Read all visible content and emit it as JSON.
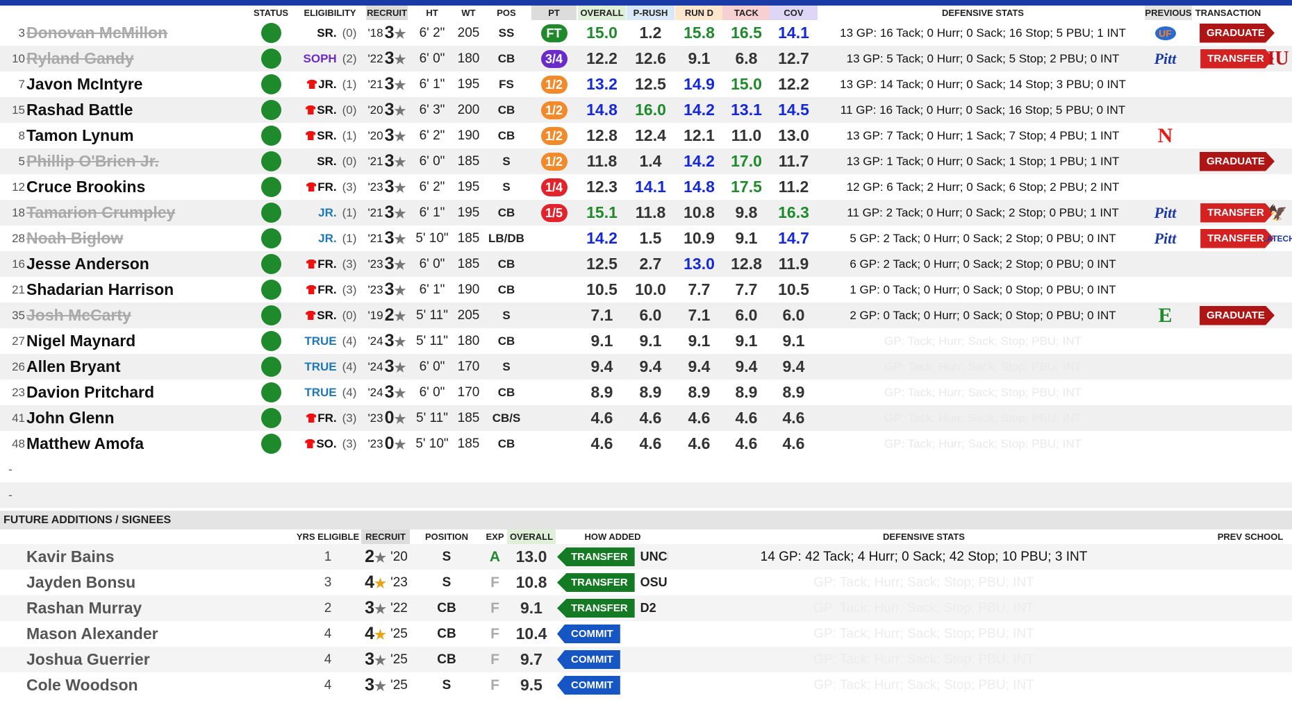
{
  "headers": {
    "status": "STATUS",
    "eligibility": "ELIGIBILITY",
    "recruit": "RECRUIT",
    "ht": "HT",
    "wt": "WT",
    "pos": "POS",
    "pt": "PT",
    "overall": "OVERALL",
    "prush": "P-RUSH",
    "rund": "RUN D",
    "tack": "TACK",
    "cov": "COV",
    "defstats": "DEFENSIVE STATS",
    "previous": "PREVIOUS",
    "transaction": "TRANSACTION"
  },
  "colors": {
    "green": "#1e8a2c",
    "blue": "#1428d8",
    "orange": "#f08a2a",
    "red": "#e3232c",
    "purple": "#6a2bc9",
    "header_blue": "#1a3aa5"
  },
  "players": [
    {
      "num": "3",
      "name": "Donovan McMillon",
      "gone": true,
      "elig": "SR.",
      "ecolor": "#111",
      "redshirt": false,
      "eyrs": "(0)",
      "yr": "'18",
      "stars": "3",
      "ht": "6' 2\"",
      "wt": "205",
      "pos": "SS",
      "pt": "FT",
      "ptc": "ft",
      "ov": "15.0",
      "ovc": "g",
      "pr": "1.2",
      "prc": "",
      "rd": "15.8",
      "rdc": "g",
      "tk": "16.5",
      "tkc": "g",
      "cv": "14.1",
      "cvc": "b",
      "ds": "13 GP: 16 Tack; 0 Hurr; 0 Sack; 16 Stop; 5 PBU; 1 INT",
      "dsf": false,
      "prev": "UF",
      "prevc": "fl",
      "trans": "GRADUATE",
      "tc": "grad",
      "next": "",
      "nextc": ""
    },
    {
      "num": "10",
      "name": "Ryland Gandy",
      "gone": true,
      "elig": "SOPH",
      "ecolor": "#6a2bc9",
      "redshirt": false,
      "eyrs": "(2)",
      "yr": "'22",
      "stars": "3",
      "ht": "6' 0\"",
      "wt": "180",
      "pos": "CB",
      "pt": "3/4",
      "ptc": "p34",
      "ov": "12.2",
      "ovc": "",
      "pr": "12.6",
      "prc": "",
      "rd": "9.1",
      "rdc": "",
      "tk": "6.8",
      "tkc": "",
      "cv": "12.7",
      "cvc": "",
      "ds": "13 GP: 5 Tack; 0 Hurr; 0 Sack; 5 Stop; 2 PBU; 0 INT",
      "dsf": false,
      "prev": "Pitt",
      "prevc": "pitt",
      "trans": "TRANSFER",
      "tc": "tr",
      "next": "IU",
      "nextc": "iu"
    },
    {
      "num": "7",
      "name": "Javon McIntyre",
      "gone": false,
      "elig": "JR.",
      "ecolor": "#111",
      "redshirt": true,
      "eyrs": "(1)",
      "yr": "'21",
      "stars": "3",
      "ht": "6' 1\"",
      "wt": "195",
      "pos": "FS",
      "pt": "1/2",
      "ptc": "p12",
      "ov": "13.2",
      "ovc": "b",
      "pr": "12.5",
      "prc": "",
      "rd": "14.9",
      "rdc": "b",
      "tk": "15.0",
      "tkc": "g",
      "cv": "12.2",
      "cvc": "",
      "ds": "13 GP: 14 Tack; 0 Hurr; 0 Sack; 14 Stop; 3 PBU; 0 INT",
      "dsf": false,
      "prev": "",
      "prevc": "",
      "trans": "",
      "tc": "",
      "next": "",
      "nextc": ""
    },
    {
      "num": "15",
      "name": "Rashad Battle",
      "gone": false,
      "elig": "SR.",
      "ecolor": "#111",
      "redshirt": true,
      "eyrs": "(0)",
      "yr": "'20",
      "stars": "3",
      "ht": "6' 3\"",
      "wt": "200",
      "pos": "CB",
      "pt": "1/2",
      "ptc": "p12",
      "ov": "14.8",
      "ovc": "b",
      "pr": "16.0",
      "prc": "g",
      "rd": "14.2",
      "rdc": "b",
      "tk": "13.1",
      "tkc": "b",
      "cv": "14.5",
      "cvc": "b",
      "ds": "11 GP: 16 Tack; 0 Hurr; 0 Sack; 16 Stop; 5 PBU; 0 INT",
      "dsf": false,
      "prev": "",
      "prevc": "",
      "trans": "",
      "tc": "",
      "next": "",
      "nextc": ""
    },
    {
      "num": "8",
      "name": "Tamon Lynum",
      "gone": false,
      "elig": "SR.",
      "ecolor": "#111",
      "redshirt": true,
      "eyrs": "(1)",
      "yr": "'20",
      "stars": "3",
      "ht": "6' 2\"",
      "wt": "190",
      "pos": "CB",
      "pt": "1/2",
      "ptc": "p12",
      "ov": "12.8",
      "ovc": "",
      "pr": "12.4",
      "prc": "",
      "rd": "12.1",
      "rdc": "",
      "tk": "11.0",
      "tkc": "",
      "cv": "13.0",
      "cvc": "",
      "ds": "13 GP: 7 Tack; 0 Hurr; 1 Sack; 7 Stop; 4 PBU; 1 INT",
      "dsf": false,
      "prev": "N",
      "prevc": "neb",
      "trans": "",
      "tc": "",
      "next": "",
      "nextc": ""
    },
    {
      "num": "5",
      "name": "Phillip O'Brien Jr.",
      "gone": true,
      "elig": "SR.",
      "ecolor": "#111",
      "redshirt": false,
      "eyrs": "(0)",
      "yr": "'21",
      "stars": "3",
      "ht": "6' 0\"",
      "wt": "185",
      "pos": "S",
      "pt": "1/2",
      "ptc": "p12",
      "ov": "11.8",
      "ovc": "",
      "pr": "1.4",
      "prc": "",
      "rd": "14.2",
      "rdc": "b",
      "tk": "17.0",
      "tkc": "g",
      "cv": "11.7",
      "cvc": "",
      "ds": "13 GP: 1 Tack; 0 Hurr; 0 Sack; 1 Stop; 1 PBU; 1 INT",
      "dsf": false,
      "prev": "",
      "prevc": "",
      "trans": "GRADUATE",
      "tc": "grad",
      "next": "",
      "nextc": ""
    },
    {
      "num": "12",
      "name": "Cruce Brookins",
      "gone": false,
      "elig": "FR.",
      "ecolor": "#111",
      "redshirt": true,
      "eyrs": "(3)",
      "yr": "'23",
      "stars": "3",
      "ht": "6' 2\"",
      "wt": "195",
      "pos": "S",
      "pt": "1/4",
      "ptc": "p14",
      "ov": "12.3",
      "ovc": "",
      "pr": "14.1",
      "prc": "b",
      "rd": "14.8",
      "rdc": "b",
      "tk": "17.5",
      "tkc": "g",
      "cv": "11.2",
      "cvc": "",
      "ds": "12 GP: 6 Tack; 2 Hurr; 0 Sack; 6 Stop; 2 PBU; 2 INT",
      "dsf": false,
      "prev": "",
      "prevc": "",
      "trans": "",
      "tc": "",
      "next": "",
      "nextc": ""
    },
    {
      "num": "18",
      "name": "Tamarion Crumpley",
      "gone": true,
      "elig": "JR.",
      "ecolor": "#1f77b4",
      "redshirt": false,
      "eyrs": "(1)",
      "yr": "'21",
      "stars": "3",
      "ht": "6' 1\"",
      "wt": "195",
      "pos": "CB",
      "pt": "1/5",
      "ptc": "p15",
      "ov": "15.1",
      "ovc": "g",
      "pr": "11.8",
      "prc": "",
      "rd": "10.8",
      "rdc": "",
      "tk": "9.8",
      "tkc": "",
      "cv": "16.3",
      "cvc": "g",
      "ds": "11 GP: 2 Tack; 0 Hurr; 0 Sack; 2 Stop; 0 PBU; 1 INT",
      "dsf": false,
      "prev": "Pitt",
      "prevc": "pitt",
      "trans": "TRANSFER",
      "tc": "tr",
      "next": "🦅",
      "nextc": "unct"
    },
    {
      "num": "28",
      "name": "Noah Biglow",
      "gone": true,
      "elig": "JR.",
      "ecolor": "#1f77b4",
      "redshirt": false,
      "eyrs": "(1)",
      "yr": "'21",
      "stars": "3",
      "ht": "5' 10\"",
      "wt": "185",
      "pos": "LB/DB",
      "pt": "",
      "ptc": "",
      "ov": "14.2",
      "ovc": "b",
      "pr": "1.5",
      "prc": "",
      "rd": "10.9",
      "rdc": "",
      "tk": "9.1",
      "tkc": "",
      "cv": "14.7",
      "cvc": "b",
      "ds": "5 GP: 2 Tack; 0 Hurr; 0 Sack; 2 Stop; 0 PBU; 0 INT",
      "dsf": false,
      "prev": "Pitt",
      "prevc": "pitt",
      "trans": "TRANSFER",
      "tc": "tr",
      "next": "LATECH",
      "nextc": "la"
    },
    {
      "num": "16",
      "name": "Jesse Anderson",
      "gone": false,
      "elig": "FR.",
      "ecolor": "#111",
      "redshirt": true,
      "eyrs": "(3)",
      "yr": "'23",
      "stars": "3",
      "ht": "6' 0\"",
      "wt": "185",
      "pos": "CB",
      "pt": "",
      "ptc": "",
      "ov": "12.5",
      "ovc": "",
      "pr": "2.7",
      "prc": "",
      "rd": "13.0",
      "rdc": "b",
      "tk": "12.8",
      "tkc": "",
      "cv": "11.9",
      "cvc": "",
      "ds": "6 GP: 2 Tack; 0 Hurr; 0 Sack; 2 Stop; 0 PBU; 0 INT",
      "dsf": false,
      "prev": "",
      "prevc": "",
      "trans": "",
      "tc": "",
      "next": "",
      "nextc": ""
    },
    {
      "num": "21",
      "name": "Shadarian Harrison",
      "gone": false,
      "elig": "FR.",
      "ecolor": "#111",
      "redshirt": true,
      "eyrs": "(3)",
      "yr": "'23",
      "stars": "3",
      "ht": "6' 1\"",
      "wt": "190",
      "pos": "CB",
      "pt": "",
      "ptc": "",
      "ov": "10.5",
      "ovc": "",
      "pr": "10.0",
      "prc": "",
      "rd": "7.7",
      "rdc": "",
      "tk": "7.7",
      "tkc": "",
      "cv": "10.5",
      "cvc": "",
      "ds": "1 GP: 0 Tack; 0 Hurr; 0 Sack; 0 Stop; 0 PBU; 0 INT",
      "dsf": false,
      "prev": "",
      "prevc": "",
      "trans": "",
      "tc": "",
      "next": "",
      "nextc": ""
    },
    {
      "num": "35",
      "name": "Josh McCarty",
      "gone": true,
      "elig": "SR.",
      "ecolor": "#111",
      "redshirt": true,
      "eyrs": "(0)",
      "yr": "'19",
      "stars": "2",
      "ht": "5' 11\"",
      "wt": "205",
      "pos": "S",
      "pt": "",
      "ptc": "",
      "ov": "7.1",
      "ovc": "",
      "pr": "6.0",
      "prc": "",
      "rd": "7.1",
      "rdc": "",
      "tk": "6.0",
      "tkc": "",
      "cv": "6.0",
      "cvc": "",
      "ds": "2 GP: 0 Tack; 0 Hurr; 0 Sack; 0 Stop; 0 PBU; 0 INT",
      "dsf": false,
      "prev": "E",
      "prevc": "emu",
      "trans": "GRADUATE",
      "tc": "grad",
      "next": "",
      "nextc": ""
    },
    {
      "num": "27",
      "name": "Nigel Maynard",
      "gone": false,
      "elig": "TRUE",
      "ecolor": "#1f77b4",
      "redshirt": false,
      "eyrs": "(4)",
      "yr": "'24",
      "stars": "3",
      "ht": "5' 11\"",
      "wt": "180",
      "pos": "CB",
      "pt": "",
      "ptc": "",
      "ov": "9.1",
      "ovc": "",
      "pr": "9.1",
      "prc": "",
      "rd": "9.1",
      "rdc": "",
      "tk": "9.1",
      "tkc": "",
      "cv": "9.1",
      "cvc": "",
      "ds": "GP: Tack; Hurr; Sack; Stop; PBU; INT",
      "dsf": true,
      "prev": "",
      "prevc": "",
      "trans": "",
      "tc": "",
      "next": "",
      "nextc": ""
    },
    {
      "num": "26",
      "name": "Allen Bryant",
      "gone": false,
      "elig": "TRUE",
      "ecolor": "#1f77b4",
      "redshirt": false,
      "eyrs": "(4)",
      "yr": "'24",
      "stars": "3",
      "ht": "6' 0\"",
      "wt": "170",
      "pos": "S",
      "pt": "",
      "ptc": "",
      "ov": "9.4",
      "ovc": "",
      "pr": "9.4",
      "prc": "",
      "rd": "9.4",
      "rdc": "",
      "tk": "9.4",
      "tkc": "",
      "cv": "9.4",
      "cvc": "",
      "ds": "GP: Tack; Hurr; Sack; Stop; PBU; INT",
      "dsf": true,
      "prev": "",
      "prevc": "",
      "trans": "",
      "tc": "",
      "next": "",
      "nextc": ""
    },
    {
      "num": "23",
      "name": "Davion Pritchard",
      "gone": false,
      "elig": "TRUE",
      "ecolor": "#1f77b4",
      "redshirt": false,
      "eyrs": "(4)",
      "yr": "'24",
      "stars": "3",
      "ht": "6' 0\"",
      "wt": "170",
      "pos": "CB",
      "pt": "",
      "ptc": "",
      "ov": "8.9",
      "ovc": "",
      "pr": "8.9",
      "prc": "",
      "rd": "8.9",
      "rdc": "",
      "tk": "8.9",
      "tkc": "",
      "cv": "8.9",
      "cvc": "",
      "ds": "GP: Tack; Hurr; Sack; Stop; PBU; INT",
      "dsf": true,
      "prev": "",
      "prevc": "",
      "trans": "",
      "tc": "",
      "next": "",
      "nextc": ""
    },
    {
      "num": "41",
      "name": "John Glenn",
      "gone": false,
      "elig": "FR.",
      "ecolor": "#111",
      "redshirt": true,
      "eyrs": "(3)",
      "yr": "'23",
      "stars": "0",
      "ht": "5' 11\"",
      "wt": "185",
      "pos": "CB/S",
      "pt": "",
      "ptc": "",
      "ov": "4.6",
      "ovc": "",
      "pr": "4.6",
      "prc": "",
      "rd": "4.6",
      "rdc": "",
      "tk": "4.6",
      "tkc": "",
      "cv": "4.6",
      "cvc": "",
      "ds": "GP: Tack; Hurr; Sack; Stop; PBU; INT",
      "dsf": true,
      "prev": "",
      "prevc": "",
      "trans": "",
      "tc": "",
      "next": "",
      "nextc": ""
    },
    {
      "num": "48",
      "name": "Matthew Amofa",
      "gone": false,
      "elig": "SO.",
      "ecolor": "#111",
      "redshirt": true,
      "eyrs": "(3)",
      "yr": "'23",
      "stars": "0",
      "ht": "5' 10\"",
      "wt": "185",
      "pos": "CB",
      "pt": "",
      "ptc": "",
      "ov": "4.6",
      "ovc": "",
      "pr": "4.6",
      "prc": "",
      "rd": "4.6",
      "rdc": "",
      "tk": "4.6",
      "tkc": "",
      "cv": "4.6",
      "cvc": "",
      "ds": "GP: Tack; Hurr; Sack; Stop; PBU; INT",
      "dsf": true,
      "prev": "",
      "prevc": "",
      "trans": "",
      "tc": "",
      "next": "",
      "nextc": ""
    }
  ],
  "empty_rows": [
    "-",
    "-"
  ],
  "future": {
    "title": "FUTURE ADDITIONS / SIGNEES",
    "headers": {
      "yrs": "YRS ELIGIBLE",
      "recruit": "RECRUIT",
      "position": "POSITION",
      "exp": "EXP",
      "overall": "OVERALL",
      "how": "HOW ADDED",
      "defstats": "DEFENSIVE STATS",
      "prev": "PREV SCHOOL"
    },
    "rows": [
      {
        "name": "Kavir Bains",
        "yrs": "1",
        "stars": "2",
        "gold": false,
        "yr": "'20",
        "pos": "S",
        "exp": "A",
        "ov": "13.0",
        "how": "TRANSFER",
        "hc": "tr",
        "hlogo": "UNCP",
        "ds": "14 GP: 42 Tack; 4 Hurr; 0 Sack; 42 Stop; 10 PBU; 3 INT",
        "dsf": false
      },
      {
        "name": "Jayden Bonsu",
        "yrs": "3",
        "stars": "4",
        "gold": true,
        "yr": "'23",
        "pos": "S",
        "exp": "F",
        "ov": "10.8",
        "how": "TRANSFER",
        "hc": "tr",
        "hlogo": "OSU",
        "ds": "GP: Tack; Hurr; Sack; Stop; PBU; INT",
        "dsf": true
      },
      {
        "name": "Rashan Murray",
        "yrs": "2",
        "stars": "3",
        "gold": false,
        "yr": "'22",
        "pos": "CB",
        "exp": "F",
        "ov": "9.1",
        "how": "TRANSFER",
        "hc": "tr",
        "hlogo": "D2",
        "ds": "GP: Tack; Hurr; Sack; Stop; PBU; INT",
        "dsf": true
      },
      {
        "name": "Mason Alexander",
        "yrs": "4",
        "stars": "4",
        "gold": true,
        "yr": "'25",
        "pos": "CB",
        "exp": "F",
        "ov": "10.4",
        "how": "COMMIT",
        "hc": "cm",
        "hlogo": "",
        "ds": "GP: Tack; Hurr; Sack; Stop; PBU; INT",
        "dsf": true
      },
      {
        "name": "Joshua Guerrier",
        "yrs": "4",
        "stars": "3",
        "gold": false,
        "yr": "'25",
        "pos": "CB",
        "exp": "F",
        "ov": "9.7",
        "how": "COMMIT",
        "hc": "cm",
        "hlogo": "",
        "ds": "GP: Tack; Hurr; Sack; Stop; PBU; INT",
        "dsf": true
      },
      {
        "name": "Cole Woodson",
        "yrs": "4",
        "stars": "3",
        "gold": false,
        "yr": "'25",
        "pos": "S",
        "exp": "F",
        "ov": "9.5",
        "how": "COMMIT",
        "hc": "cm",
        "hlogo": "",
        "ds": "GP: Tack; Hurr; Sack; Stop; PBU; INT",
        "dsf": true
      }
    ]
  }
}
